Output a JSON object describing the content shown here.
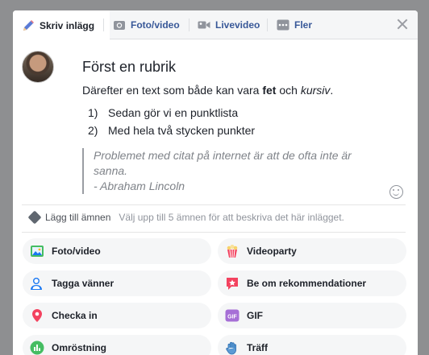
{
  "tabs": [
    {
      "label": "Skriv inlägg",
      "icon": "pencil-icon"
    },
    {
      "label": "Foto/video",
      "icon": "camera-icon"
    },
    {
      "label": "Livevideo",
      "icon": "video-camera-icon"
    },
    {
      "label": "Fler",
      "icon": "more-icon"
    }
  ],
  "post": {
    "heading": "Först en rubrik",
    "para_start": "Därefter en text som både kan vara ",
    "para_bold": "fet",
    "para_mid": " och ",
    "para_italic": "kursiv",
    "para_end": ".",
    "list": [
      {
        "num": "1)",
        "text": "Sedan gör vi en punktlista"
      },
      {
        "num": "2)",
        "text": "Med hela två stycken punkter"
      }
    ],
    "quote_line1": "Problemet med citat på internet är att de ofta inte är",
    "quote_line2": "sanna.",
    "quote_line3": "- Abraham Lincoln"
  },
  "topics": {
    "label": "Lägg till ämnen",
    "hint": "Välj upp till 5 ämnen för att beskriva det här inlägget."
  },
  "actions": [
    {
      "label": "Foto/video",
      "icon": "photo-icon"
    },
    {
      "label": "Videoparty",
      "icon": "popcorn-icon"
    },
    {
      "label": "Tagga vänner",
      "icon": "tag-friends-icon"
    },
    {
      "label": "Be om rekommendationer",
      "icon": "recommendation-icon"
    },
    {
      "label": "Checka in",
      "icon": "location-pin-icon"
    },
    {
      "label": "GIF",
      "icon": "gif-icon"
    },
    {
      "label": "Omröstning",
      "icon": "poll-icon"
    },
    {
      "label": "Träff",
      "icon": "wave-hand-icon"
    }
  ],
  "colors": {
    "link_blue": "#385898",
    "accent_green": "#45bd62",
    "accent_red": "#f3425f",
    "accent_purple": "#a66fd6"
  }
}
